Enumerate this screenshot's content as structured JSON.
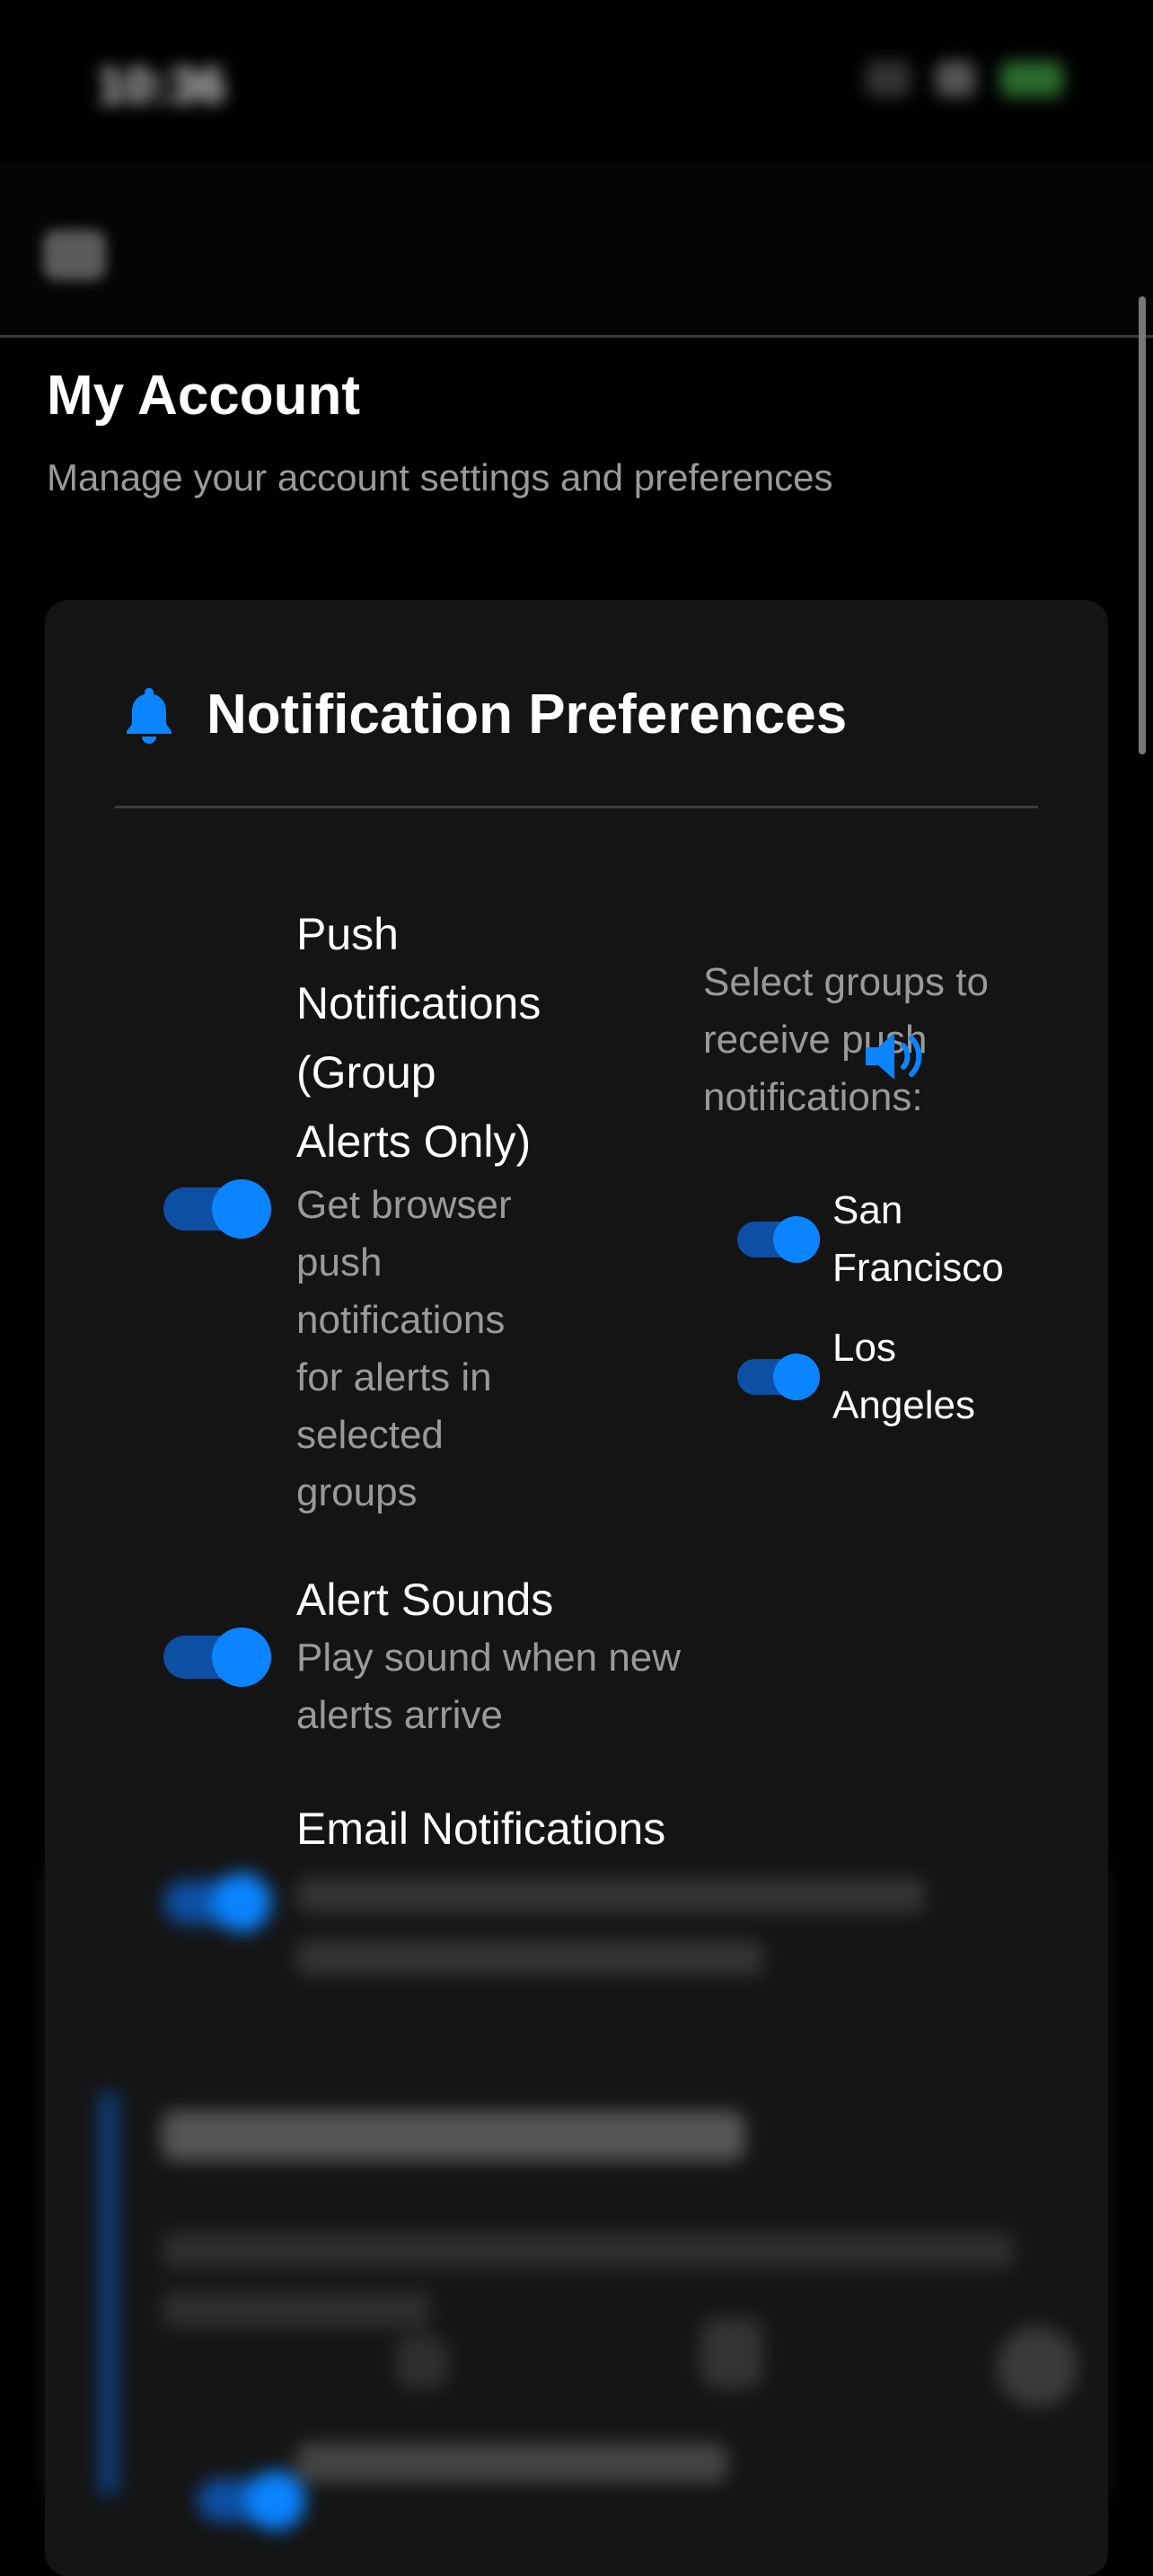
{
  "status_bar": {
    "time": "10:36"
  },
  "page": {
    "title": "My Account",
    "subtitle": "Manage your account settings and preferences"
  },
  "card": {
    "title": "Notification Preferences",
    "icon": "bell-icon",
    "accent": "#0a84ff"
  },
  "push": {
    "title_lines": [
      "Push",
      "Notifications",
      "(Group",
      "Alerts Only)"
    ],
    "desc_lines": [
      "Get browser",
      "push",
      "notifications",
      "for alerts in",
      "selected",
      "groups"
    ],
    "enabled": true,
    "groups_prompt_lines": [
      "Select groups to",
      "receive push",
      "notifications:"
    ],
    "groups": [
      {
        "name_lines": [
          "San",
          "Francisco"
        ],
        "enabled": true
      },
      {
        "name_lines": [
          "Los",
          "Angeles"
        ],
        "enabled": true
      }
    ]
  },
  "sounds": {
    "title": "Alert Sounds",
    "desc_lines": [
      "Play sound when new",
      "alerts arrive"
    ],
    "enabled": true,
    "icon": "speaker-icon"
  },
  "email": {
    "title": "Email Notifications",
    "enabled": true
  }
}
